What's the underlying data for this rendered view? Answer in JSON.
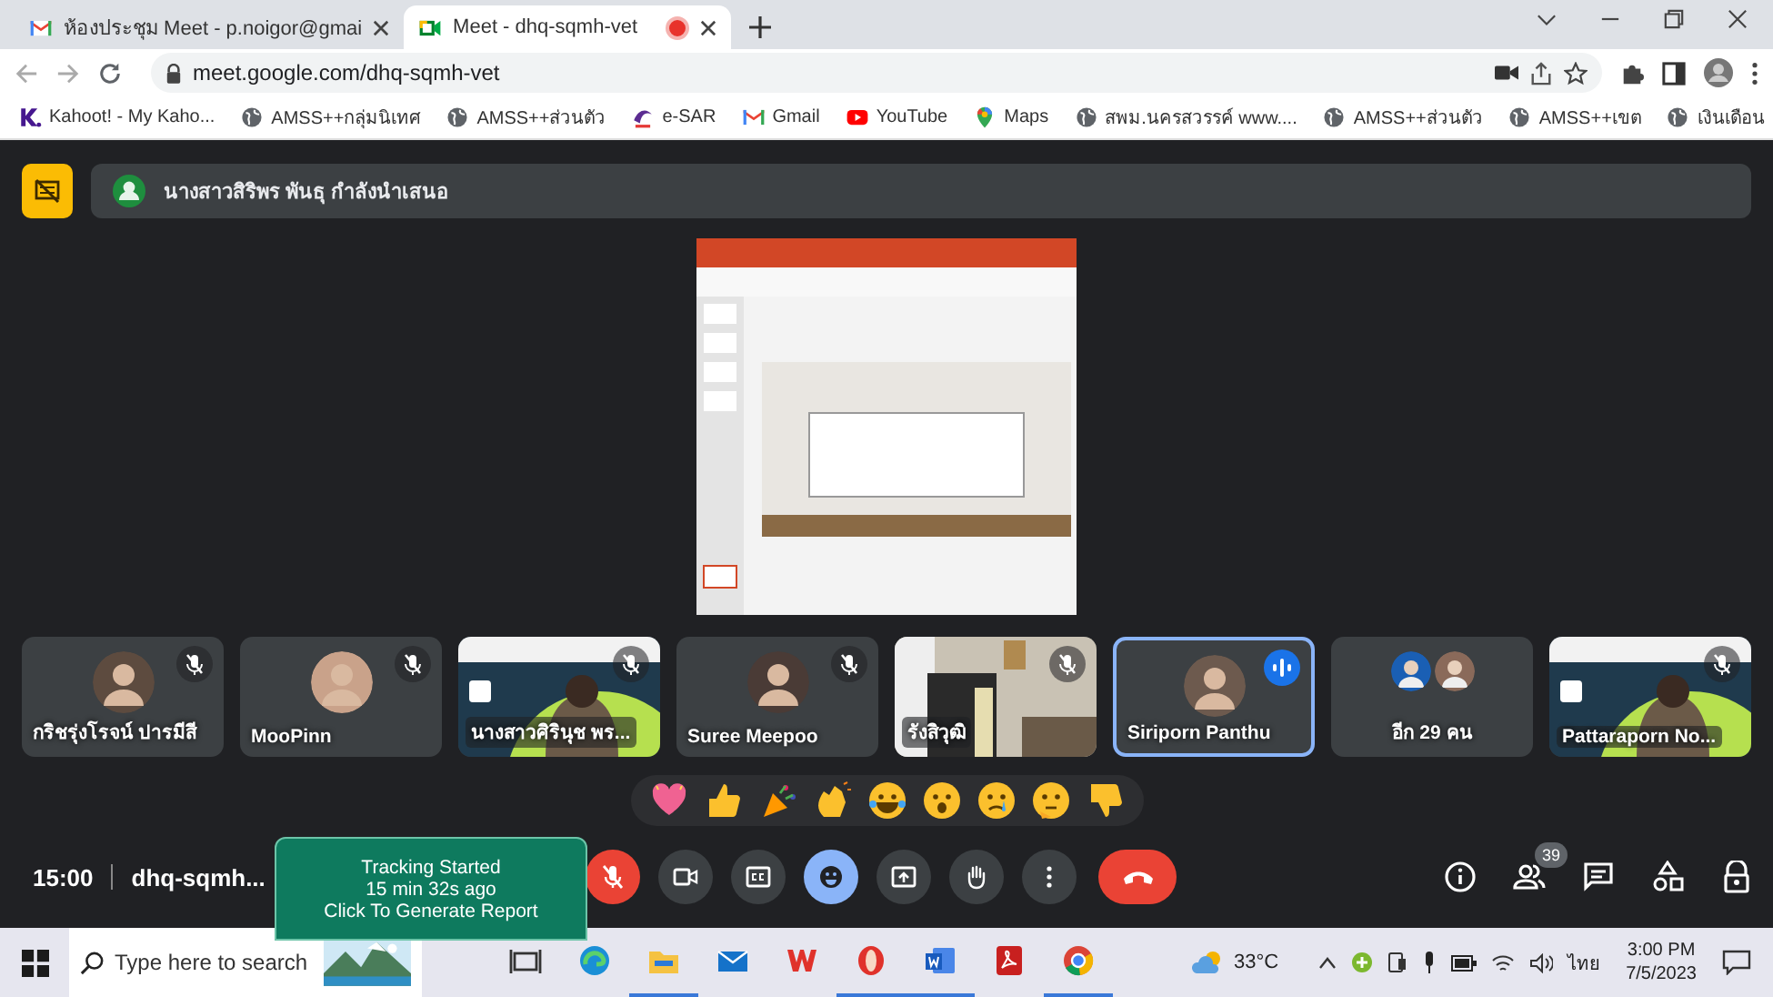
{
  "browser": {
    "tabs": [
      {
        "title": "ห้องประชุม Meet - p.noigor@gmai",
        "kind": "gmail",
        "selected": false,
        "recording": false
      },
      {
        "title": "Meet - dhq-sqmh-vet",
        "kind": "meet",
        "selected": true,
        "recording": true
      }
    ],
    "address": "meet.google.com/dhq-sqmh-vet",
    "bookmarks": [
      {
        "label": "Kahoot! - My Kaho...",
        "kind": "kahoot"
      },
      {
        "label": "AMSS++กลุ่มนิเทศ",
        "kind": "globe"
      },
      {
        "label": "AMSS++ส่วนตัว",
        "kind": "globe"
      },
      {
        "label": "e-SAR",
        "kind": "esar"
      },
      {
        "label": "Gmail",
        "kind": "gmail"
      },
      {
        "label": "YouTube",
        "kind": "youtube"
      },
      {
        "label": "Maps",
        "kind": "maps"
      },
      {
        "label": "สพม.นครสวรรค์ www....",
        "kind": "globe"
      },
      {
        "label": "AMSS++ส่วนตัว",
        "kind": "globe"
      },
      {
        "label": "AMSS++เขต",
        "kind": "globe"
      },
      {
        "label": "เงินเดือน",
        "kind": "globe"
      }
    ]
  },
  "meet": {
    "presenter_banner": "นางสาวสิริพร พันธุ กำลังนำเสนอ",
    "tiles": [
      {
        "name": "กริชรุ่งโรจน์ ปารมีสี",
        "kind": "avatar",
        "muted": true,
        "speaking": false
      },
      {
        "name": "MooPinn",
        "kind": "avatar",
        "muted": true,
        "speaking": false
      },
      {
        "name": "นางสาวศิรินุช พร...",
        "kind": "video",
        "muted": true,
        "speaking": false
      },
      {
        "name": "Suree Meepoo",
        "kind": "avatar",
        "muted": true,
        "speaking": false
      },
      {
        "name": "รังสิวุฒิ",
        "kind": "video",
        "muted": true,
        "speaking": false
      },
      {
        "name": "Siriporn Panthu",
        "kind": "avatar",
        "muted": false,
        "speaking": true
      },
      {
        "name": "อีก 29 คน",
        "kind": "others",
        "muted": false,
        "speaking": false
      },
      {
        "name": "Pattaraporn No...",
        "kind": "video",
        "muted": true,
        "speaking": false
      }
    ],
    "meeting_time": "15:00",
    "meeting_code": "dhq-sqmh...",
    "tracking": [
      "Tracking Started",
      "15 min 32s ago",
      "Click To Generate Report"
    ],
    "mic_muted": true,
    "reactions_open": true,
    "people_count": "39"
  },
  "taskbar": {
    "search_placeholder": "Type here to search",
    "apps": [
      {
        "kind": "taskview",
        "open": false
      },
      {
        "kind": "edge",
        "open": false
      },
      {
        "kind": "explorer",
        "open": true
      },
      {
        "kind": "mail",
        "open": false
      },
      {
        "kind": "wps",
        "open": false
      },
      {
        "kind": "opera",
        "open": true
      },
      {
        "kind": "word",
        "open": true
      },
      {
        "kind": "pdf",
        "open": false
      },
      {
        "kind": "chrome",
        "open": true
      }
    ],
    "temperature": "33°C",
    "language": "ไทย",
    "time": "3:00 PM",
    "date": "7/5/2023"
  }
}
